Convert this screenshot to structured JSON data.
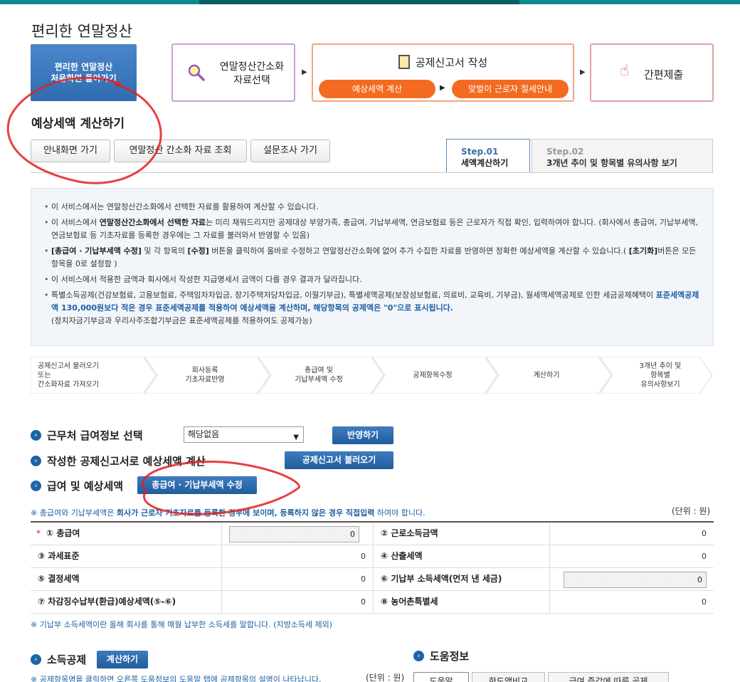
{
  "page": {
    "title": "편리한 연말정산"
  },
  "home_button": {
    "line1": "편리한 연말정산",
    "line2": "처음화면 돌아가기"
  },
  "steps": {
    "simplify": {
      "line1": "연말정산간소화",
      "line2": "자료선택"
    },
    "write": {
      "title": "공제신고서 작성",
      "pill1": "예상세액 계산",
      "pill2": "맞벌이 근로자 절세안내"
    },
    "submit": {
      "label": "간편제출"
    }
  },
  "section": {
    "title": "예상세액 계산하기"
  },
  "nav_buttons": {
    "home": "안내화면 가기",
    "view": "연말정산 간소화 자료 조회",
    "survey": "설문조사 가기"
  },
  "tabs": [
    {
      "step": "Step.01",
      "label": "세액계산하기"
    },
    {
      "step": "Step.02",
      "label": "3개년 추이 및 항목별 유의사항 보기"
    }
  ],
  "info": {
    "b1": "이 서비스에서는 연말정산간소화에서 선택한 자료를 활용하여 계산할 수 있습니다.",
    "b2_pre": "이 서비스에서 ",
    "b2_bold": "연말정산간소화에서 선택한 자료",
    "b2_post": "는 미리 채워드리지만 공제대상 부양가족, 총급여, 기납부세액, 연금보험료 등은 근로자가 직접 확인, 입력하여야 합니다. (회사에서 총급여, 기납부세액, 연금보험료 등 기초자료를 등록한 경우에는 그 자료를 불러와서 반영할 수 있음)",
    "b3_bold1": "[총급여 · 기납부세액 수정]",
    "b3_mid1": " 및 각 항목의 ",
    "b3_bold2": "[수정]",
    "b3_mid2": " 버튼을 클릭하여 올바로 수정하고 연말정산간소화에 없어 추가 수집한 자료를 반영하면 정확한 예상세액을 계산할 수 있습니다.( ",
    "b3_bold3": "[초기화]",
    "b3_post": "버튼은 모든 항목을 0로 설정함 )",
    "b4": "이 서비스에서 적용한 금액과 회사에서 작성한 지급명세서 금액이 다를 경우 결과가 달라집니다.",
    "b5_pre": "특별소득공제(건강보험료, 고용보험료, 주택임차차입금, 장기주택저당차입금, 이월기부금), 특별세액공제(보장성보험료, 의료비, 교육비, 기부금), 월세액세액공제로 인한 세금공제혜택이 ",
    "b5_hl": "표준세액공제액 130,000원보다 적은 경우 표준세액공제를 적용하여 예상세액을 계산하며, 해당항목의 공제액은 \"0\"으로 표시됩니다.",
    "b5_post": "(정치자금기부금과 우리사주조합기부금은 표준세액공제를 적용하여도 공제가능)"
  },
  "flow": [
    {
      "line1": "공제신고서 불러오기",
      "line2": "또는",
      "line3": "간소화자료 가져오기"
    },
    {
      "line1": "회사등록",
      "line2": "기초자료반영",
      "line3": ""
    },
    {
      "line1": "총급여 및",
      "line2": "기납부세액 수정",
      "line3": ""
    },
    {
      "line1": "공제항목수정",
      "line2": "",
      "line3": ""
    },
    {
      "line1": "계산하기",
      "line2": "",
      "line3": ""
    },
    {
      "line1": "3개년 추이 및",
      "line2": "항목별",
      "line3": "유의사항보기"
    }
  ],
  "workplace": {
    "label": "근무처 급여정보 선택",
    "select_value": "해당없음",
    "apply_button": "반영하기"
  },
  "load_form": {
    "label": "작성한 공제신고서로 예상세액 계산",
    "button": "공제신고서 불러오기"
  },
  "salary": {
    "label": "급여 및 예상세액",
    "button": "총급여 · 기납부세액 수정"
  },
  "salary_note": {
    "pre": "※ 총급여와 기납부세액은 ",
    "bold": "회사가 근로자 기초자료를 등록한 경우에 보이며, 등록하지 않은 경우 직접입력",
    "post": " 하여야 합니다."
  },
  "unit": "(단위 : 원)",
  "unit2": "(단위 : 원)",
  "table": {
    "required_mark": "*",
    "rows": [
      {
        "l1": "① 총급여",
        "v1": "0",
        "l2": "② 근로소득금액",
        "v2": "0"
      },
      {
        "l1": "③ 과세표준",
        "v1": "0",
        "l2": "④ 산출세액",
        "v2": "0"
      },
      {
        "l1": "⑤ 결정세액",
        "v1": "0",
        "l2": "⑥ 기납부 소득세액(먼저 낸 세금)",
        "v2": "0"
      },
      {
        "l1": "⑦ 차감징수납부(환급)예상세액(⑤-⑥)",
        "v1": "0",
        "l2": "⑧ 농어촌특별세",
        "v2": "0"
      }
    ]
  },
  "table_note": "※ 기납부 소득세액이란 올해 회사를 통해 매월 납부한 소득세를 말합니다. (지방소득세 제외)",
  "income_deduction": {
    "label": "소득공제",
    "button": "계산하기"
  },
  "help": {
    "label": "도움정보",
    "tab1": "도움말",
    "tab2": "한도액비교",
    "tab3": "급여 증감에 따른 공제"
  },
  "bottom_note": "※ 공제항목명을 클릭하면 오른쪽 도움정보의 도움말 탭에 공제항목의 설명이 나타납니다."
}
